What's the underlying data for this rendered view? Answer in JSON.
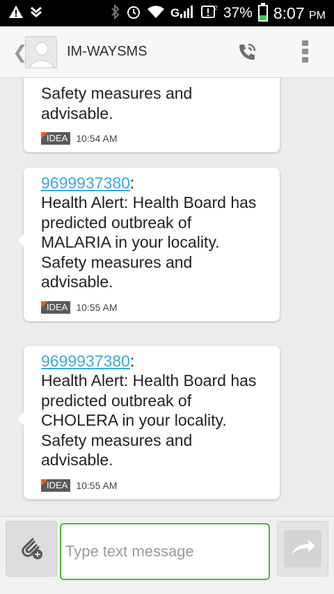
{
  "status_bar": {
    "battery_text": "37%",
    "battery_level": 0.37,
    "time": "8:07",
    "ampm": "PM",
    "icons": [
      "warning-icon",
      "download-icon",
      "bluetooth-icon",
      "alarm-icon",
      "wifi-icon",
      "signal-icon",
      "sim-notification-icon",
      "battery-icon"
    ]
  },
  "header": {
    "contact_name": "IM-WAYSMS",
    "back_glyph": "❮",
    "icons": [
      "back-arrow-icon",
      "contact-avatar-icon",
      "call-icon",
      "overflow-menu-icon"
    ]
  },
  "messages": [
    {
      "sender": "",
      "text": "Safety measures and\nadvisable.",
      "sim_label": "IDEA",
      "time": "10:54 AM"
    },
    {
      "sender": "9699937380",
      "colon": ":",
      "text": "Health Alert: Health Board has\npredicted outbreak of\nMALARIA in your locality.\nSafety measures and\nadvisable.",
      "sim_label": "IDEA",
      "time": "10:55 AM"
    },
    {
      "sender": "9699937380",
      "colon": ":",
      "text": "Health Alert: Health Board has\npredicted outbreak of\nCHOLERA in your locality.\nSafety measures and\nadvisable.",
      "sim_label": "IDEA",
      "time": "10:55 AM"
    }
  ],
  "compose": {
    "placeholder": "Type text message",
    "value": "",
    "icons": [
      "attach-icon",
      "send-icon"
    ]
  },
  "colors": {
    "accent_green": "#4cbb3c",
    "link_blue": "#3aa9dc",
    "sim_orange": "#e5601c"
  }
}
